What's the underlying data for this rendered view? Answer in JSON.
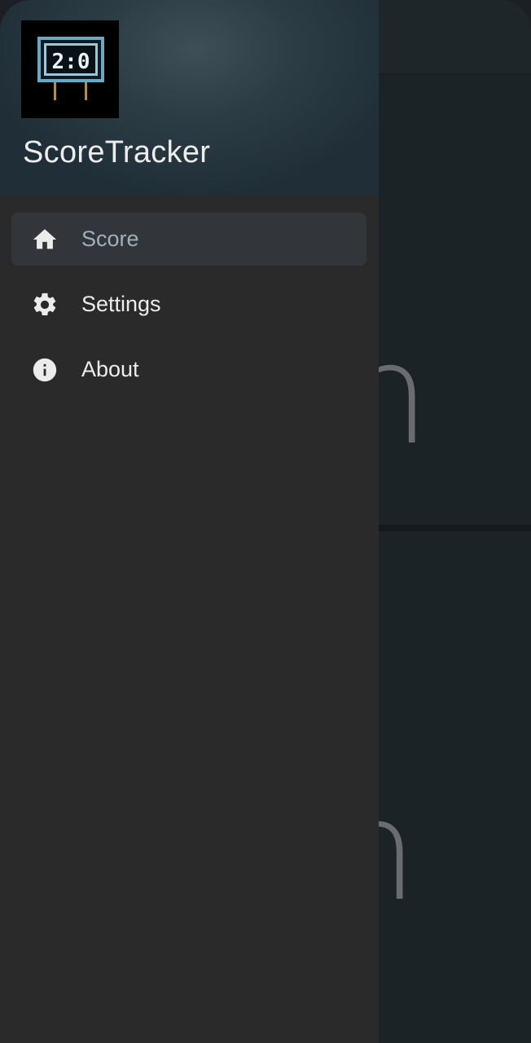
{
  "app": {
    "title": "ScoreTracker",
    "logo_display": "2:0"
  },
  "navigation": {
    "items": [
      {
        "label": "Score",
        "icon": "home-icon",
        "active": true
      },
      {
        "label": "Settings",
        "icon": "gear-icon",
        "active": false
      },
      {
        "label": "About",
        "icon": "info-icon",
        "active": false
      }
    ]
  },
  "background_app": {
    "top_score": "n",
    "bottom_score": "n"
  },
  "colors": {
    "drawer_bg": "#2a2a2a",
    "header_bg": "#2d3d46",
    "active_item_bg": "#32363a",
    "active_label": "#9fb0bb",
    "text_primary": "#ececec"
  }
}
